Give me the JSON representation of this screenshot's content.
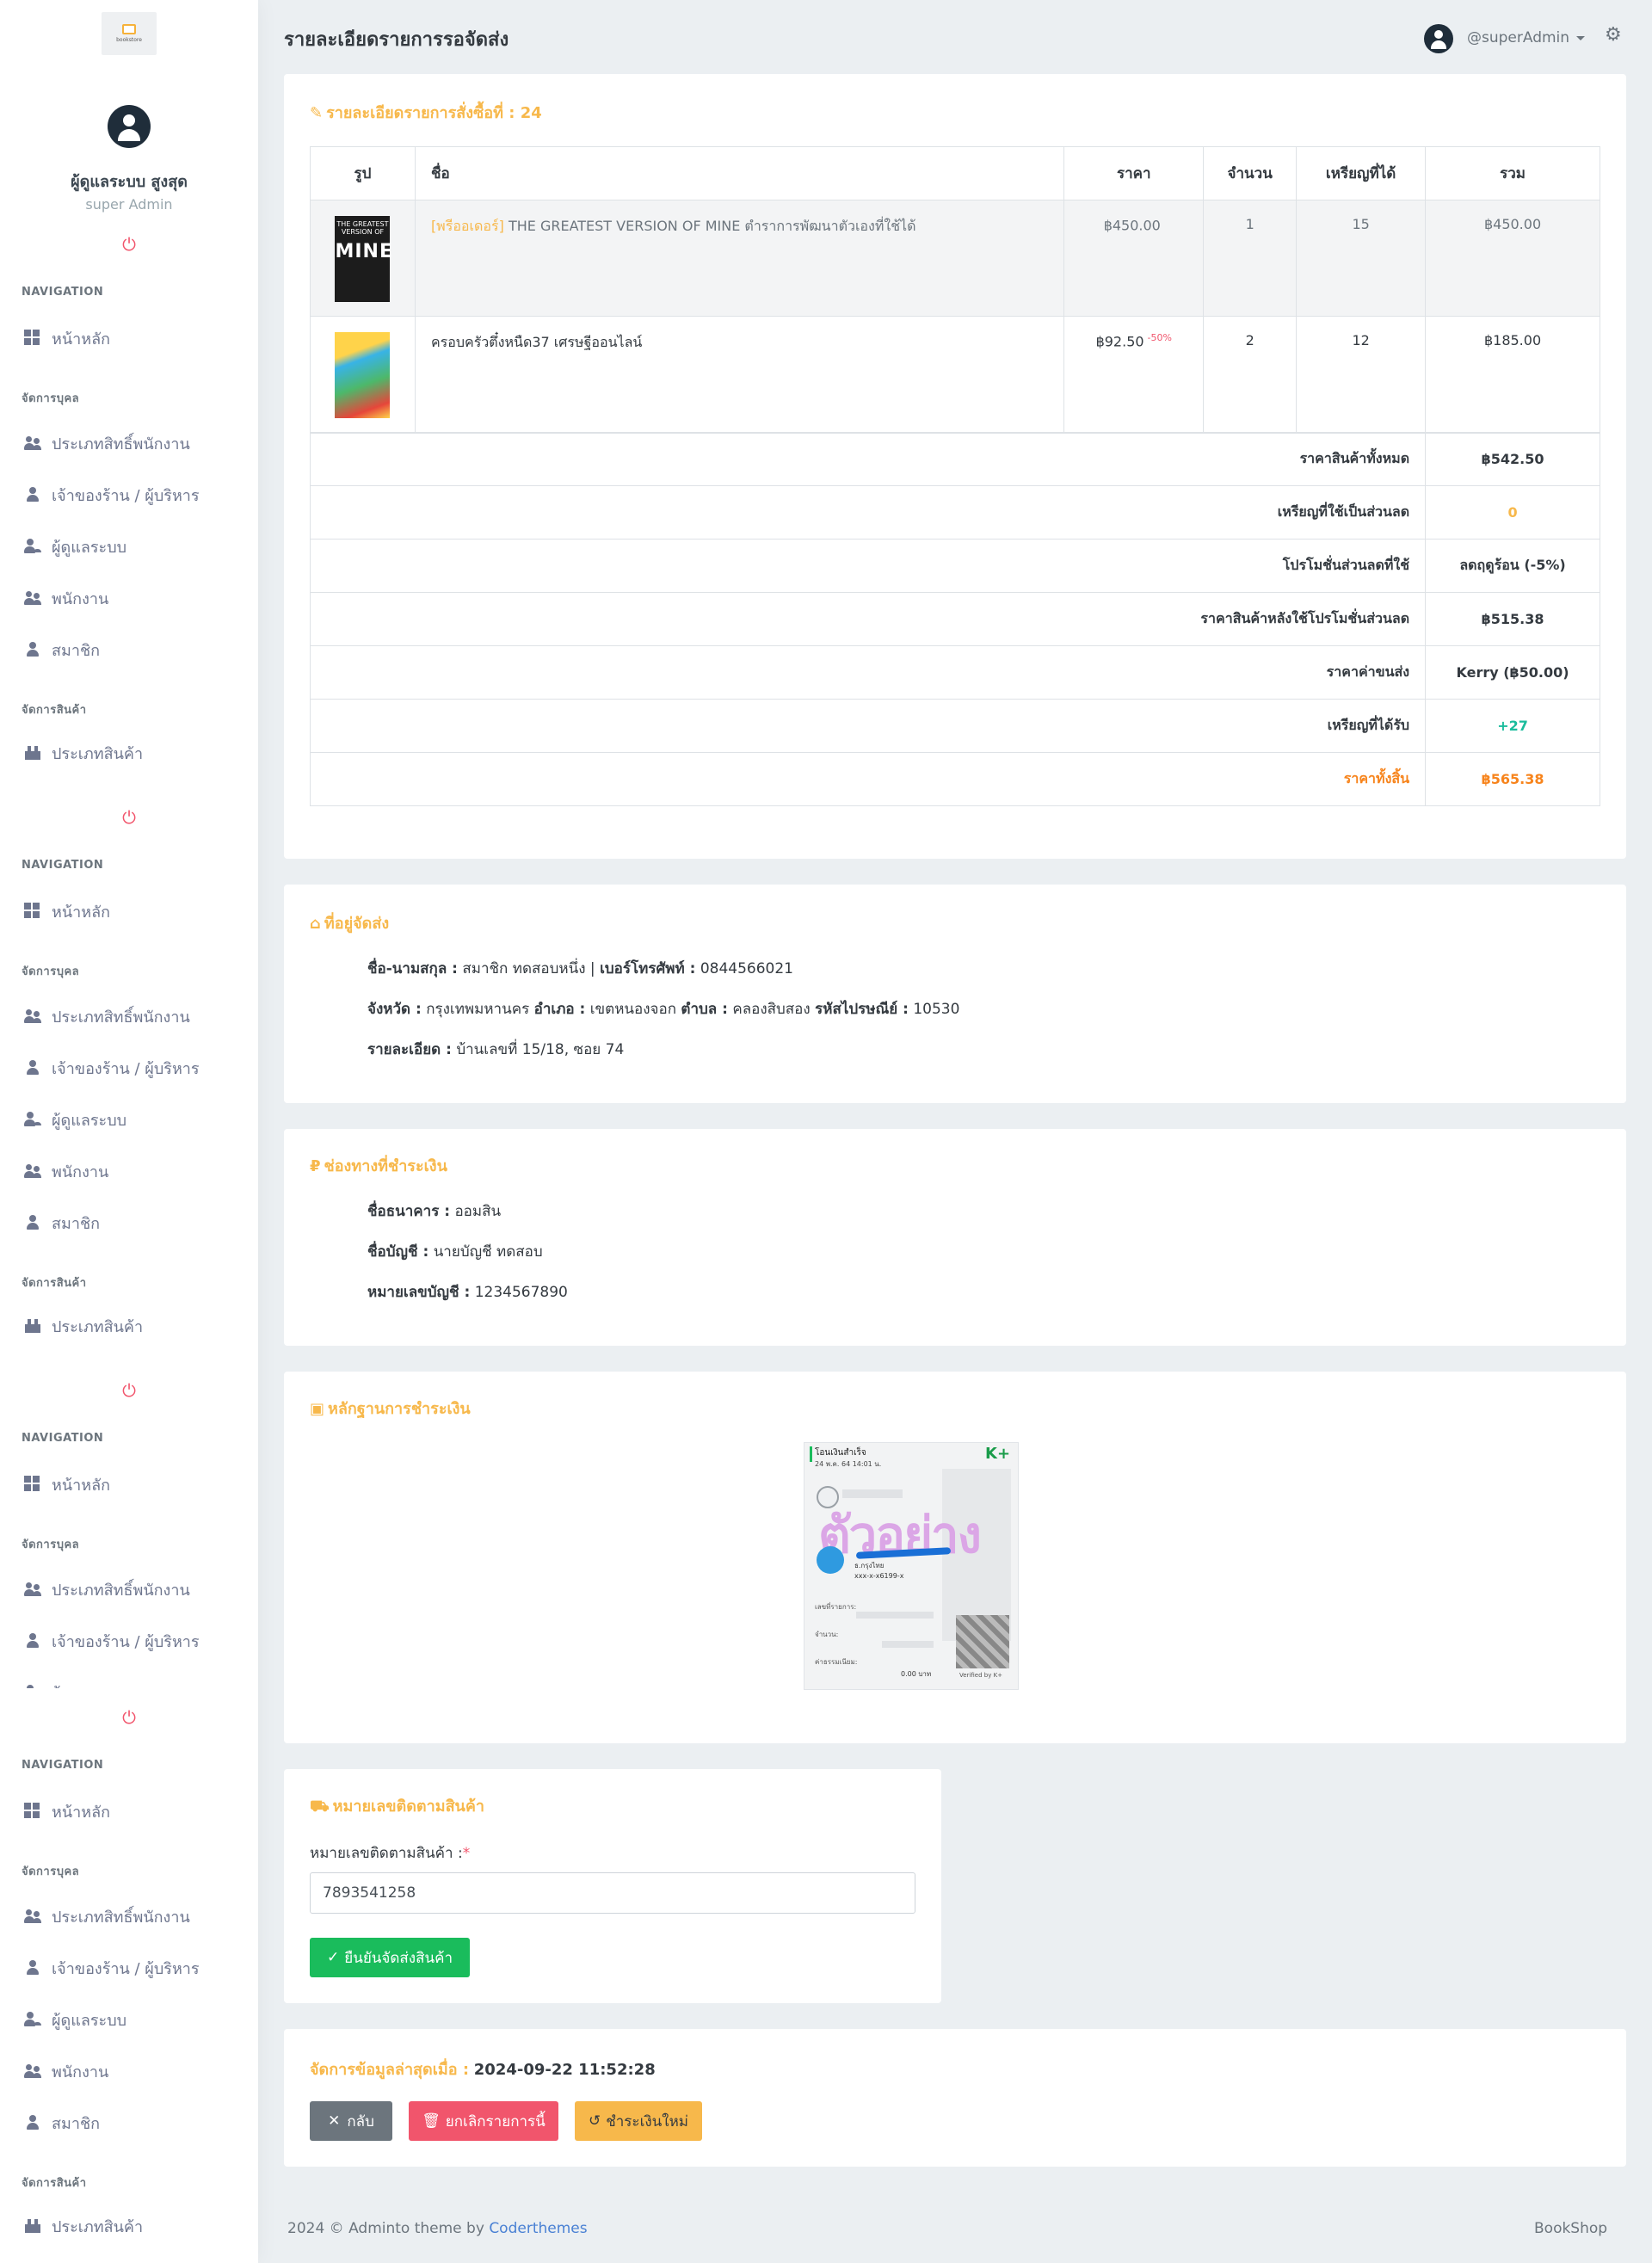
{
  "sidebar": {
    "logo_text": "bookstore",
    "username": "ผู้ดูแลระบบ สูงสุด",
    "role": "super Admin",
    "nav_title": "NAVIGATION",
    "home": "หน้าหลัก",
    "people_title": "จัดการบุคล",
    "perm": "ประเภทสิทธิ์พนักงาน",
    "owner": "เจ้าของร้าน / ผู้บริหาร",
    "admin": "ผู้ดูแลระบบ",
    "staff": "พนักงาน",
    "member": "สมาชิก",
    "product_title": "จัดการสินค้า",
    "product_type": "ประเภทสินค้า",
    "power_icon": "power-icon"
  },
  "topbar": {
    "page_title": "รายละเอียดรายการรอจัดส่ง",
    "user": "@superAdmin"
  },
  "order": {
    "title": "รายละเอียดรายการสั่งซื้อที่ : 24",
    "headers": [
      "รูป",
      "ชื่อ",
      "ราคา",
      "จำนวน",
      "เหรียญที่ได้",
      "รวม"
    ],
    "items": [
      {
        "tag": "[พรีออเดอร์]",
        "name": "THE GREATEST VERSION OF MINE ตำราการพัฒนาตัวเองที่ใช้ได้",
        "price": "฿450.00",
        "discount": "",
        "qty": "1",
        "coins": "15",
        "total": "฿450.00",
        "cover_top": "THE GREATEST VERSION OF",
        "cover_big": "MINE"
      },
      {
        "tag": "",
        "name": "ครอบครัวตึ๋งหนืด37 เศรษฐีออนไลน์",
        "price": "฿92.50",
        "discount": "-50%",
        "qty": "2",
        "coins": "12",
        "total": "฿185.00",
        "cover_top": "",
        "cover_big": ""
      }
    ],
    "summary": [
      {
        "label": "ราคาสินค้าทั้งหมด",
        "value": "฿542.50",
        "color": "#343a40"
      },
      {
        "label": "เหรียญที่ใช้เป็นส่วนลด",
        "value": "0",
        "color": "#f7b84b"
      },
      {
        "label": "โปรโมชั่นส่วนลดที่ใช้",
        "value": "ลดฤดูร้อน (-5%)",
        "color": "#343a40"
      },
      {
        "label": "ราคาสินค้าหลังใช้โปรโมชั่นส่วนลด",
        "value": "฿515.38",
        "color": "#343a40"
      },
      {
        "label": "ราคาค่าขนส่ง",
        "value": "Kerry (฿50.00)",
        "color": "#343a40"
      },
      {
        "label": "เหรียญที่ได้รับ",
        "value": "+27",
        "color": "#1abc9c"
      },
      {
        "label": "ราคาทั้งสิ้น",
        "value": "฿565.38",
        "color": "#f7841c"
      }
    ]
  },
  "address": {
    "title": "ที่อยู่จัดส่ง",
    "name_label": "ชื่อ-นามสกุล :",
    "name": "สมาชิก ทดสอบหนึ่ง",
    "phone_label": "เบอร์โทรศัพท์ :",
    "phone": "0844566021",
    "province_label": "จังหวัด :",
    "province": "กรุงเทพมหานคร",
    "district_label": "อำเภอ :",
    "district": "เขตหนองจอก",
    "subdistrict_label": "ตำบล :",
    "subdistrict": "คลองสิบสอง",
    "zip_label": "รหัสไปรษณีย์ :",
    "zip": "10530",
    "detail_label": "รายละเอียด :",
    "detail": "บ้านเลขที่ 15/18, ซอย 74"
  },
  "payment": {
    "title": "ช่องทางที่ชำระเงิน",
    "bank_label": "ชื่อธนาคาร :",
    "bank": "ออมสิน",
    "account_label": "ชื่อบัญชี :",
    "account": "นายบัญชี ทดสอบ",
    "number_label": "หมายเลขบัญชี :",
    "number": "1234567890"
  },
  "proof": {
    "title": "หลักฐานการชำระเงิน",
    "slip_header": "โอนเงินสำเร็จ",
    "slip_date": "24 พ.ค. 64 14:01 น.",
    "slip_logo": "K+",
    "slip_watermark": "ตัวอย่าง",
    "slip_bank": "ธ.กรุงไทย",
    "slip_acct": "xxx-x-x6199-x",
    "slip_ref": "เลขที่รายการ:",
    "slip_amount": "จำนวน:",
    "slip_fee": "ค่าธรรมเนียม:",
    "slip_fee_val": "0.00 บาท",
    "slip_verified": "Verified by K+"
  },
  "tracking": {
    "title": "หมายเลขติดตามสินค้า",
    "label": "หมายเลขติดตามสินค้า :",
    "required": "*",
    "value": "7893541258",
    "confirm": "ยืนยันจัดส่งสินค้า"
  },
  "actions": {
    "updated_label": "จัดการข้อมูลล่าสุดเมื่อ :",
    "updated_value": "2024-09-22 11:52:28",
    "back": "กลับ",
    "cancel": "ยกเลิกรายการนี้",
    "repay": "ชำระเงินใหม่"
  },
  "footer": {
    "text": "2024 © Adminto theme by",
    "brand": "Coderthemes",
    "right": "BookShop"
  },
  "colors": {
    "accent": "#f7b84b",
    "success": "#1abc5c",
    "danger": "#f1556c",
    "secondary": "#6c757d"
  }
}
